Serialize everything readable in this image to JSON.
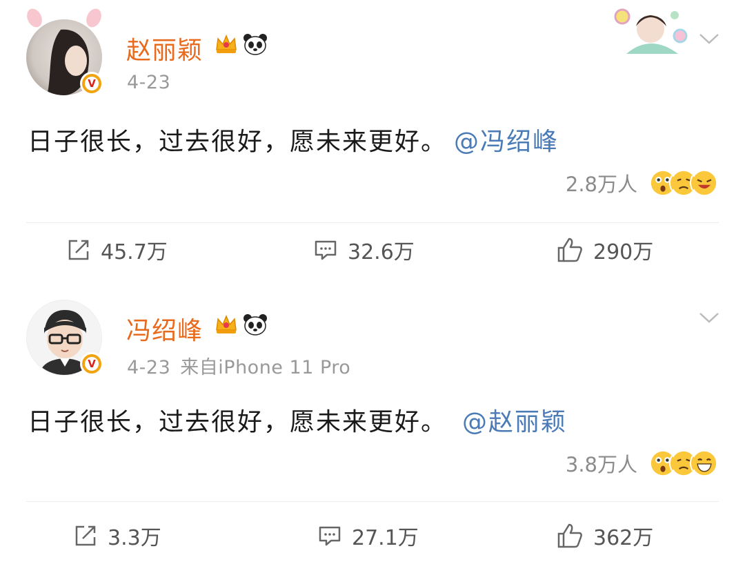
{
  "posts": [
    {
      "username": "赵丽颖",
      "date": "4-23",
      "source": "",
      "text": "日子很长，过去很好，愿未来更好。",
      "mention": "@冯绍峰",
      "reaction_count": "2.8万人",
      "repost_count": "45.7万",
      "comment_count": "32.6万",
      "like_count": "290万"
    },
    {
      "username": "冯绍峰",
      "date": "4-23",
      "source": "来自iPhone 11 Pro",
      "text": "日子很长，过去很好，愿未来更好。",
      "mention": "@赵丽颖",
      "reaction_count": "3.8万人",
      "repost_count": "3.3万",
      "comment_count": "27.1万",
      "like_count": "362万"
    }
  ],
  "colors": {
    "username": "#e86a1d",
    "mention": "#4a7bb7",
    "meta": "#999999",
    "verified_badge": "#f2a311"
  },
  "icons": [
    "crown-icon",
    "panda-icon",
    "verified-icon",
    "chevron-down-icon",
    "repost-icon",
    "comment-icon",
    "like-icon"
  ]
}
